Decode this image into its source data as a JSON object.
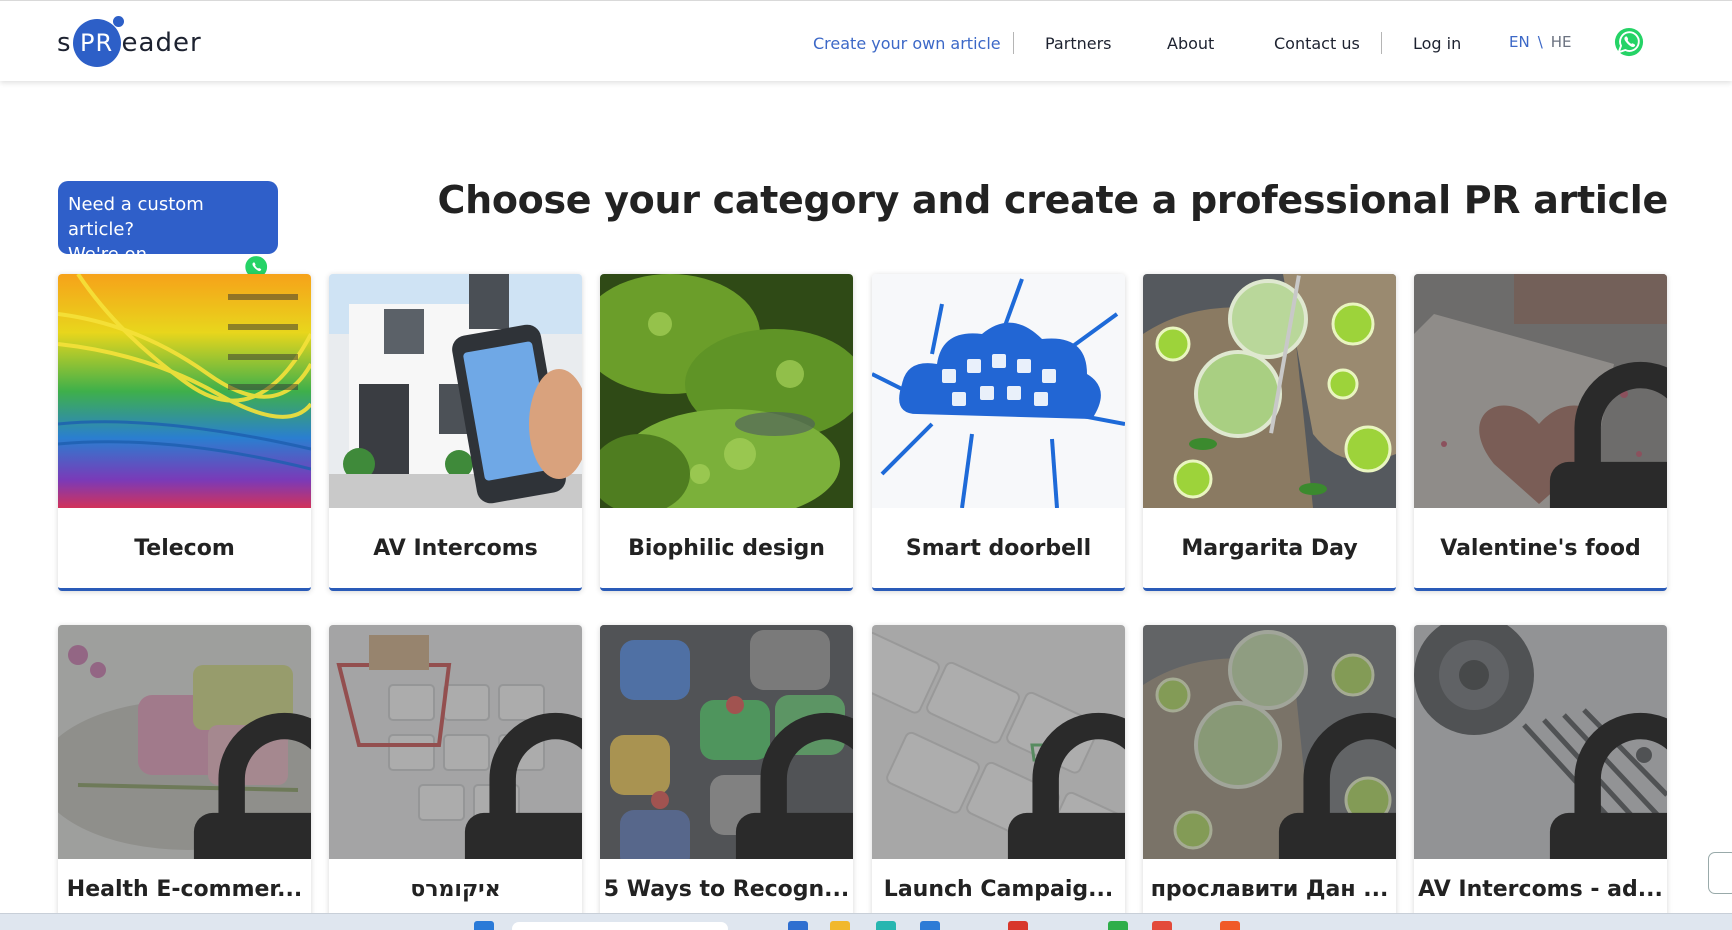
{
  "brand": {
    "logo_left": "s",
    "logo_mid": "PR",
    "logo_right": "eader"
  },
  "nav": {
    "create": "Create your own article",
    "partners": "Partners",
    "about": "About",
    "contact": "Contact us",
    "login": "Log in",
    "lang_en": "EN",
    "lang_sep": "\\",
    "lang_he": "HE"
  },
  "hero": {
    "badge_line1": "Need a custom article?",
    "badge_line2": "We're on WhatsApp!",
    "title": "Choose your category and create a professional PR article"
  },
  "cards": [
    {
      "label": "Telecom",
      "locked": false
    },
    {
      "label": "AV Intercoms",
      "locked": false
    },
    {
      "label": "Biophilic design",
      "locked": false
    },
    {
      "label": "Smart doorbell",
      "locked": false
    },
    {
      "label": "Margarita Day",
      "locked": false
    },
    {
      "label": "Valentine's food",
      "locked": true
    },
    {
      "label": "Health E-commer...",
      "locked": true
    },
    {
      "label": "איקומרס",
      "locked": true
    },
    {
      "label": "5 Ways to Recogn...",
      "locked": true
    },
    {
      "label": "Launch Campaig...",
      "locked": true
    },
    {
      "label": "прославити Дан ...",
      "locked": true
    },
    {
      "label": "AV Intercoms - ad...",
      "locked": true
    }
  ],
  "colors": {
    "accent": "#2d5fc7",
    "nav_link": "#3c68c7",
    "whatsapp": "#25d366"
  }
}
